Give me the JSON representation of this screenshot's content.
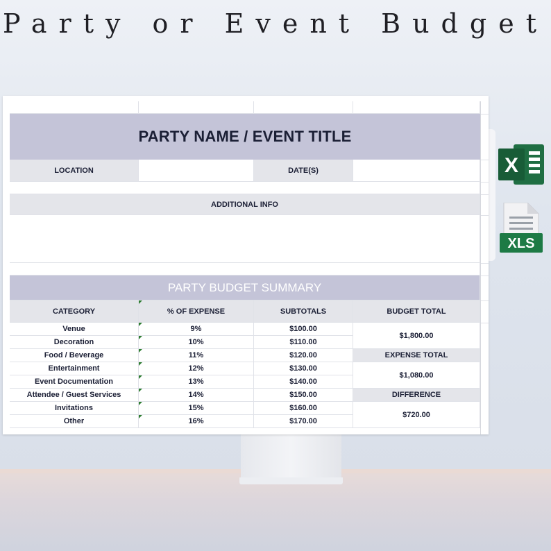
{
  "headline": "Party or Event Budget",
  "sheet": {
    "title": "PARTY NAME / EVENT TITLE",
    "location_label": "LOCATION",
    "dates_label": "DATE(S)",
    "additional_info_label": "ADDITIONAL INFO",
    "summary_title": "PARTY BUDGET SUMMARY",
    "columns": [
      "CATEGORY",
      "% OF EXPENSE",
      "SUBTOTALS",
      "BUDGET TOTAL"
    ],
    "rows": [
      {
        "category": "Venue",
        "percent": "9%",
        "subtotal": "$100.00"
      },
      {
        "category": "Decoration",
        "percent": "10%",
        "subtotal": "$110.00"
      },
      {
        "category": "Food / Beverage",
        "percent": "11%",
        "subtotal": "$120.00"
      },
      {
        "category": "Entertainment",
        "percent": "12%",
        "subtotal": "$130.00"
      },
      {
        "category": "Event Documentation",
        "percent": "13%",
        "subtotal": "$140.00"
      },
      {
        "category": "Attendee / Guest Services",
        "percent": "14%",
        "subtotal": "$150.00"
      },
      {
        "category": "Invitations",
        "percent": "15%",
        "subtotal": "$160.00"
      },
      {
        "category": "Other",
        "percent": "16%",
        "subtotal": "$170.00"
      }
    ],
    "totals": {
      "budget_total_value": "$1,800.00",
      "expense_total_label": "EXPENSE TOTAL",
      "expense_total_value": "$1,080.00",
      "difference_label": "DIFFERENCE",
      "difference_value": "$720.00"
    }
  },
  "icons": {
    "excel_letter": "X",
    "xls_label": "XLS",
    "excel_color": "#1f6e43",
    "xls_badge_color": "#1d7a45"
  },
  "colors": {
    "header_band": "#c4c4d8",
    "label_band": "#e4e5ea",
    "text_dark": "#1b1f35"
  }
}
